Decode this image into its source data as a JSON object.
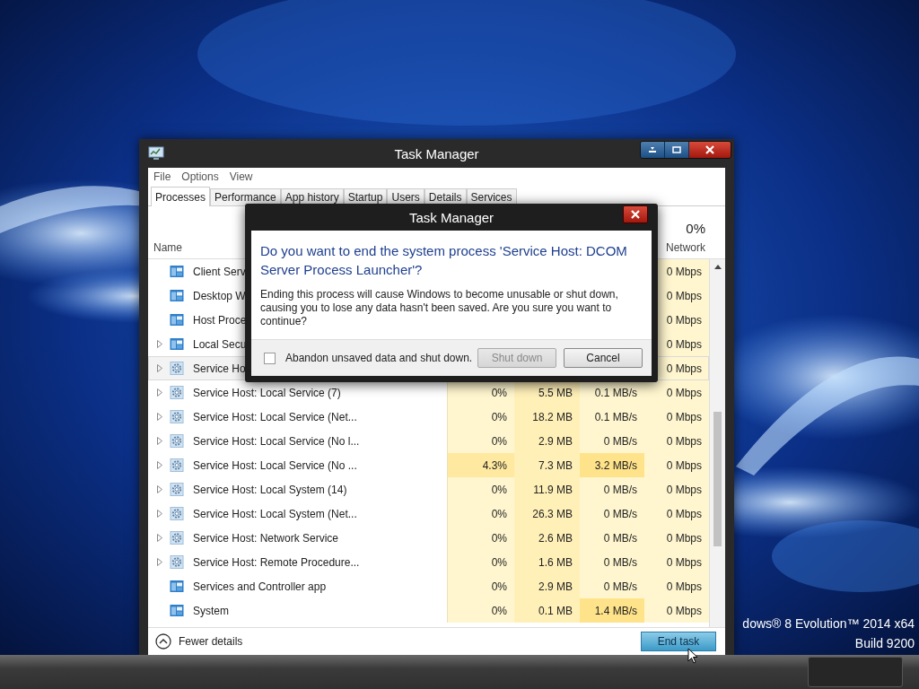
{
  "desktop": {
    "edition": "dows® 8 Evolution™ 2014 x64",
    "build": "Build 9200"
  },
  "window": {
    "title": "Task Manager",
    "menu": [
      "File",
      "Options",
      "View"
    ],
    "tabs": [
      {
        "label": "Processes",
        "selected": true
      },
      {
        "label": "Performance",
        "selected": false
      },
      {
        "label": "App history",
        "selected": false
      },
      {
        "label": "Startup",
        "selected": false
      },
      {
        "label": "Users",
        "selected": false
      },
      {
        "label": "Details",
        "selected": false
      },
      {
        "label": "Services",
        "selected": false
      }
    ],
    "table": {
      "name_heading": "Name",
      "network_heading": {
        "usage": "0%",
        "label": "Network"
      },
      "rows": [
        {
          "name": "Client Serv",
          "kind": "app",
          "expandable": false,
          "selected": false,
          "network": "0 Mbps"
        },
        {
          "name": "Desktop W",
          "kind": "app",
          "expandable": false,
          "selected": false,
          "network": "0 Mbps"
        },
        {
          "name": "Host Proce",
          "kind": "app",
          "expandable": false,
          "selected": false,
          "network": "0 Mbps"
        },
        {
          "name": "Local Secu",
          "kind": "app",
          "expandable": true,
          "selected": false,
          "network": "0 Mbps"
        },
        {
          "name": "Service Ho",
          "kind": "service",
          "expandable": true,
          "selected": true,
          "network": "0 Mbps"
        },
        {
          "name": "Service Host: Local Service (7)",
          "kind": "service",
          "expandable": true,
          "selected": false,
          "cpu": {
            "text": "0%",
            "hot": false
          },
          "memory": {
            "text": "5.5 MB",
            "hot": false
          },
          "disk": {
            "text": "0.1 MB/s",
            "hot": false
          },
          "network": "0 Mbps"
        },
        {
          "name": "Service Host: Local Service (Net...",
          "kind": "service",
          "expandable": true,
          "selected": false,
          "cpu": {
            "text": "0%",
            "hot": false
          },
          "memory": {
            "text": "18.2 MB",
            "hot": false
          },
          "disk": {
            "text": "0.1 MB/s",
            "hot": false
          },
          "network": "0 Mbps"
        },
        {
          "name": "Service Host: Local Service (No l...",
          "kind": "service",
          "expandable": true,
          "selected": false,
          "cpu": {
            "text": "0%",
            "hot": false
          },
          "memory": {
            "text": "2.9 MB",
            "hot": false
          },
          "disk": {
            "text": "0 MB/s",
            "hot": false
          },
          "network": "0 Mbps"
        },
        {
          "name": "Service Host: Local Service (No ...",
          "kind": "service",
          "expandable": true,
          "selected": false,
          "cpu": {
            "text": "4.3%",
            "hot": true
          },
          "memory": {
            "text": "7.3 MB",
            "hot": false
          },
          "disk": {
            "text": "3.2 MB/s",
            "hot": true
          },
          "network": "0 Mbps"
        },
        {
          "name": "Service Host: Local System (14)",
          "kind": "service",
          "expandable": true,
          "selected": false,
          "cpu": {
            "text": "0%",
            "hot": false
          },
          "memory": {
            "text": "11.9 MB",
            "hot": false
          },
          "disk": {
            "text": "0 MB/s",
            "hot": false
          },
          "network": "0 Mbps"
        },
        {
          "name": "Service Host: Local System (Net...",
          "kind": "service",
          "expandable": true,
          "selected": false,
          "cpu": {
            "text": "0%",
            "hot": false
          },
          "memory": {
            "text": "26.3 MB",
            "hot": false
          },
          "disk": {
            "text": "0 MB/s",
            "hot": false
          },
          "network": "0 Mbps"
        },
        {
          "name": "Service Host: Network Service",
          "kind": "service",
          "expandable": true,
          "selected": false,
          "cpu": {
            "text": "0%",
            "hot": false
          },
          "memory": {
            "text": "2.6 MB",
            "hot": false
          },
          "disk": {
            "text": "0 MB/s",
            "hot": false
          },
          "network": "0 Mbps"
        },
        {
          "name": "Service Host: Remote Procedure...",
          "kind": "service",
          "expandable": true,
          "selected": false,
          "cpu": {
            "text": "0%",
            "hot": false
          },
          "memory": {
            "text": "1.6 MB",
            "hot": false
          },
          "disk": {
            "text": "0 MB/s",
            "hot": false
          },
          "network": "0 Mbps"
        },
        {
          "name": "Services and Controller app",
          "kind": "app",
          "expandable": false,
          "selected": false,
          "cpu": {
            "text": "0%",
            "hot": false
          },
          "memory": {
            "text": "2.9 MB",
            "hot": false
          },
          "disk": {
            "text": "0 MB/s",
            "hot": false
          },
          "network": "0 Mbps"
        },
        {
          "name": "System",
          "kind": "app",
          "expandable": false,
          "selected": false,
          "cpu": {
            "text": "0%",
            "hot": false
          },
          "memory": {
            "text": "0.1 MB",
            "hot": false
          },
          "disk": {
            "text": "1.4 MB/s",
            "hot": true
          },
          "network": "0 Mbps"
        }
      ]
    },
    "footer": {
      "fewer_details": "Fewer details",
      "end_task": "End task"
    }
  },
  "dialog": {
    "title": "Task Manager",
    "heading": "Do you want to end the system process 'Service Host: DCOM Server Process Launcher'?",
    "message": "Ending this process will cause Windows to become unusable or shut down, causing you to lose any data hasn't been saved. Are you sure you want to continue?",
    "checkbox": {
      "label": "Abandon unsaved data and shut down.",
      "checked": false
    },
    "buttons": [
      {
        "label": "Shut down",
        "disabled": true
      },
      {
        "label": "Cancel",
        "disabled": false
      }
    ]
  }
}
